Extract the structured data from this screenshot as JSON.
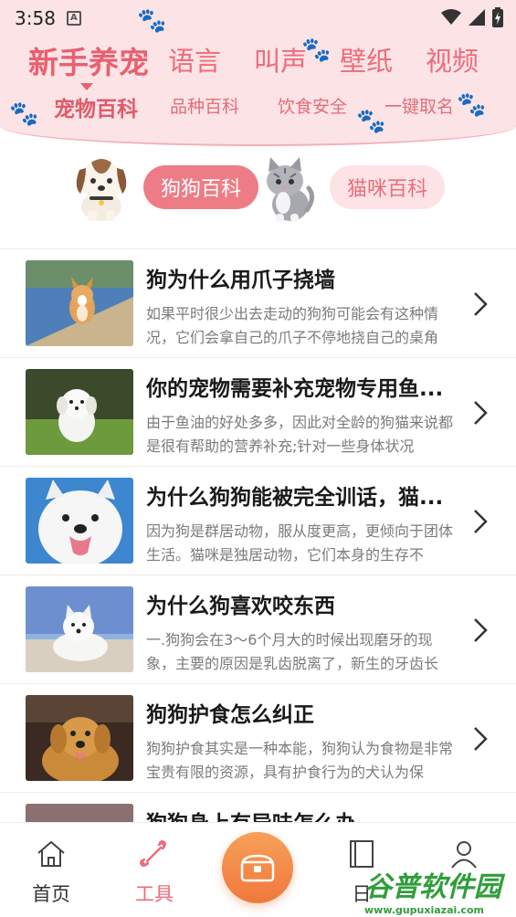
{
  "status_bar": {
    "time": "3:58",
    "sim_icon": "A"
  },
  "header": {
    "tabs": [
      {
        "label": "新手养宠",
        "active": true
      },
      {
        "label": "语言"
      },
      {
        "label": "叫声"
      },
      {
        "label": "壁纸"
      },
      {
        "label": "视频"
      }
    ],
    "subtabs": [
      {
        "label": "宠物百科",
        "active": true
      },
      {
        "label": "品种百科"
      },
      {
        "label": "饮食安全"
      },
      {
        "label": "一键取名"
      }
    ]
  },
  "toggle": {
    "dog_label": "狗狗百科",
    "cat_label": "猫咪百科"
  },
  "articles": [
    {
      "title": "狗为什么用爪子挠墙",
      "desc": "如果平时很少出去走动的狗狗可能会有这种情况，它们会拿自己的爪子不停地挠自己的桌角"
    },
    {
      "title": "你的宠物需要补充宠物专用鱼...",
      "desc": "由于鱼油的好处多多，因此对全龄的狗猫来说都是很有帮助的营养补充;针对一些身体状况"
    },
    {
      "title": "为什么狗狗能被完全训话，猫...",
      "desc": "因为狗是群居动物，服从度更高，更倾向于团体生活。猫咪是独居动物，它们本身的生存不"
    },
    {
      "title": "为什么狗喜欢咬东西",
      "desc": "一.狗狗会在3～6个月大的时候出现磨牙的现象，主要的原因是乳齿脱离了，新生的牙齿长"
    },
    {
      "title": "狗狗护食怎么纠正",
      "desc": "狗狗护食其实是一种本能，狗狗认为食物是非常宝贵有限的资源，具有护食行为的犬认为保"
    },
    {
      "title": "狗狗身上有异味怎么办",
      "desc": ""
    }
  ],
  "bottom_nav": {
    "home_label": "首页",
    "tools_label": "工具",
    "diary_label": "日",
    "active": "工具"
  },
  "watermark": {
    "brand": "谷普软件园",
    "url": "www.gupuxiazai.com"
  },
  "colors": {
    "accent": "#ef6b79",
    "header_bg": "#fbe3e6",
    "center_button": "#f0783b"
  }
}
